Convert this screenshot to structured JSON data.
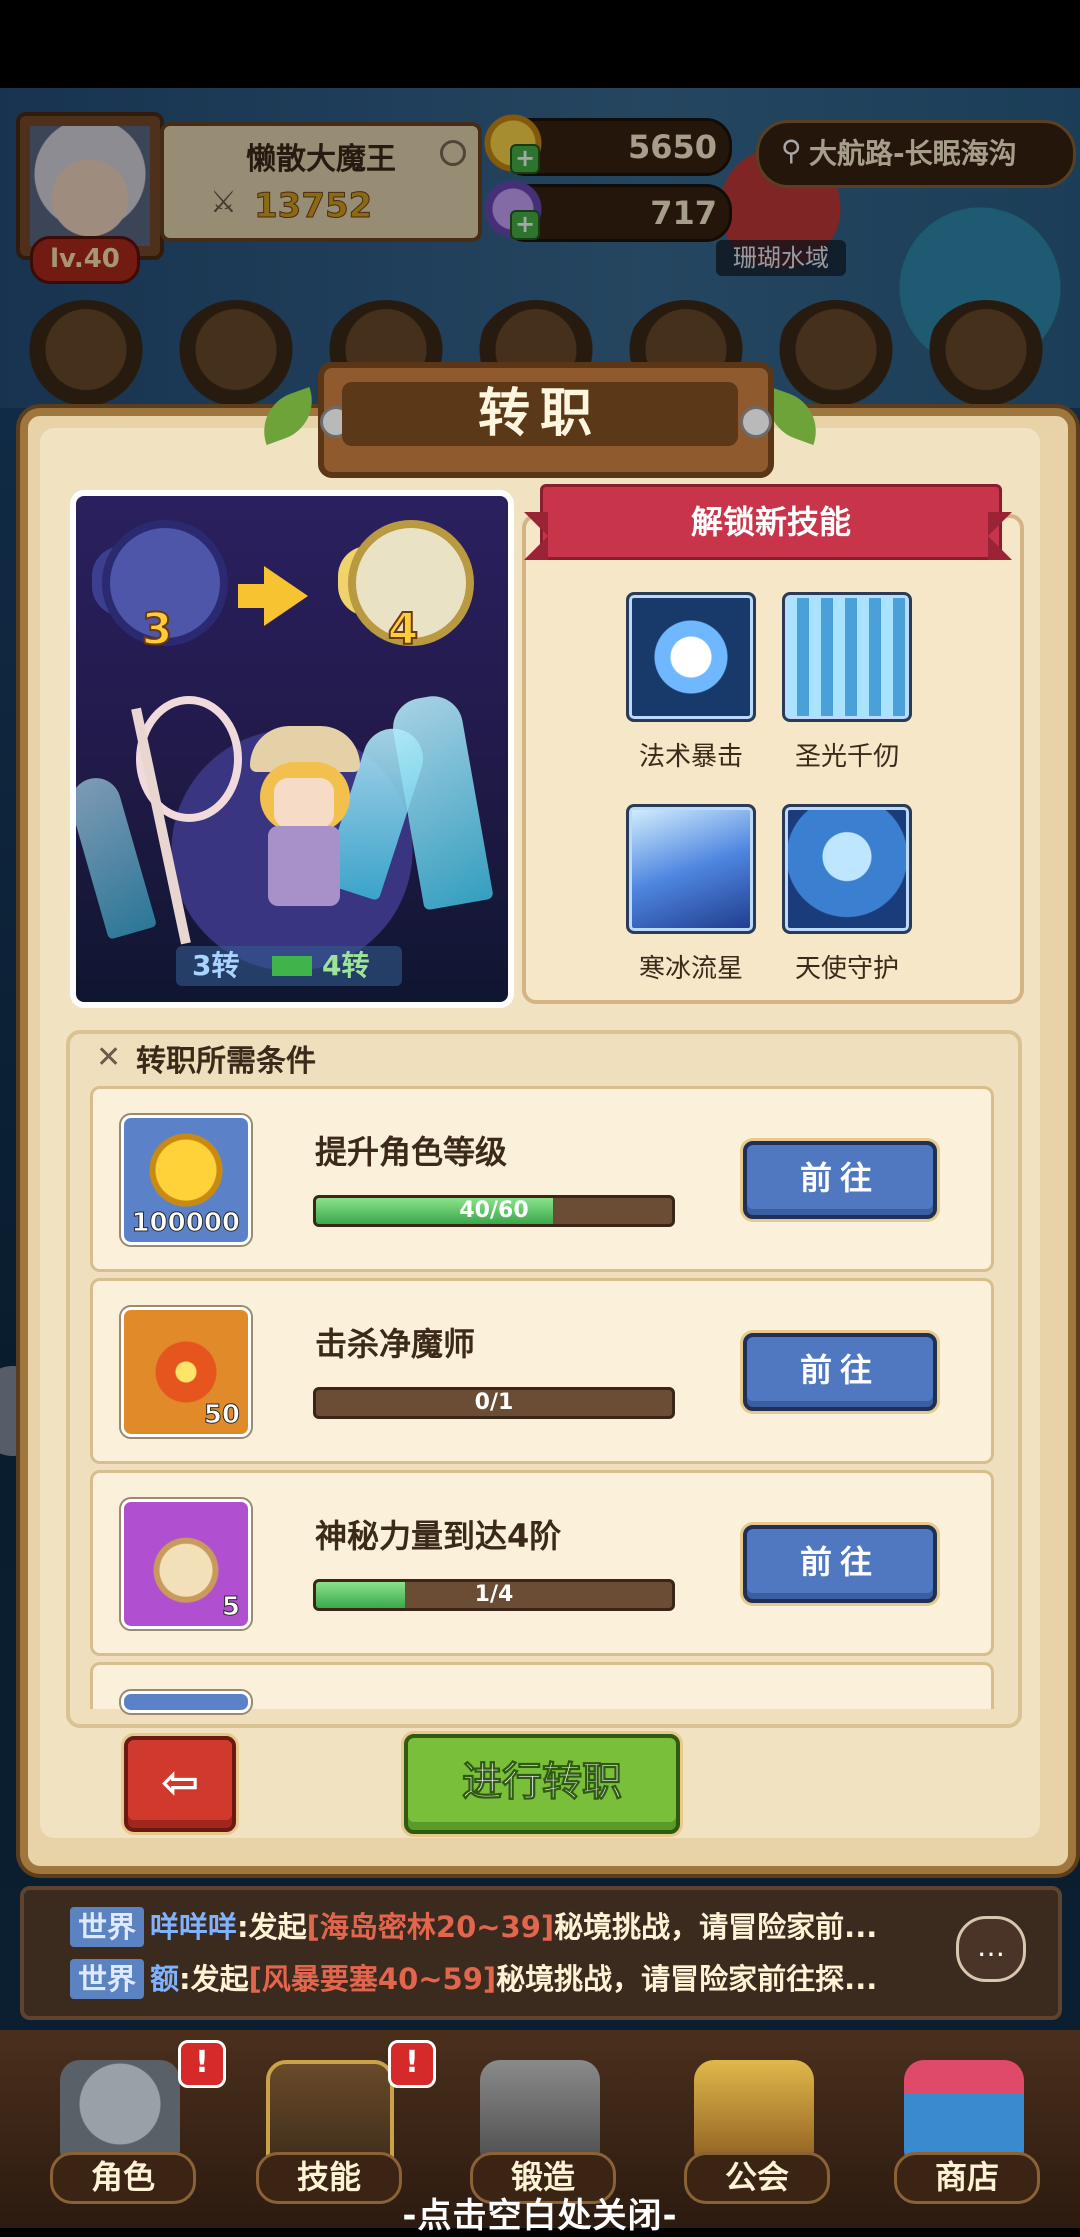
{
  "player": {
    "name": "懒散大魔王",
    "power": "13752",
    "level": "lv.40"
  },
  "resources": {
    "gold": "5650",
    "gems": "717"
  },
  "location": {
    "route": "大航路-长眠海沟",
    "region": "珊瑚水域"
  },
  "dialog": {
    "title": "转职",
    "preview": {
      "from_rank": "3",
      "to_rank": "4",
      "from_label": "3转",
      "to_label": "4转"
    },
    "skills_header": "解锁新技能",
    "skills": [
      {
        "name": "法术暴击",
        "icon": "spell-crit-icon"
      },
      {
        "name": "圣光千仞",
        "icon": "holy-light-icon"
      },
      {
        "name": "寒冰流星",
        "icon": "ice-meteor-icon"
      },
      {
        "name": "天使守护",
        "icon": "angel-guard-icon"
      }
    ],
    "conditions_title": "转职所需条件",
    "conditions": [
      {
        "label": "提升角色等级",
        "item": "gold-coin-icon",
        "item_count": "100000",
        "progress_text": "40/60",
        "progress": 0.667,
        "button": "前往"
      },
      {
        "label": "击杀净魔师",
        "item": "red-star-icon",
        "item_count": "50",
        "progress_text": "0/1",
        "progress": 0.0,
        "button": "前往"
      },
      {
        "label": "神秘力量到达4阶",
        "item": "fruit-tart-icon",
        "item_count": "5",
        "progress_text": "1/4",
        "progress": 0.25,
        "button": "前往"
      }
    ],
    "confirm": "进行转职"
  },
  "chat": [
    {
      "tag": "世界",
      "user": "咩咩咩",
      "prefix": ":发起",
      "highlight": "[海岛密林20~39]",
      "rest": "秘境挑战，请冒险家前..."
    },
    {
      "tag": "世界",
      "user": "额",
      "prefix": ":发起",
      "highlight": "[风暴要塞40~59]",
      "rest": "秘境挑战，请冒险家前往探..."
    }
  ],
  "nav": [
    {
      "label": "角色",
      "alert": "!"
    },
    {
      "label": "技能",
      "alert": "!"
    },
    {
      "label": "锻造",
      "alert": ""
    },
    {
      "label": "公会",
      "alert": ""
    },
    {
      "label": "商店",
      "alert": ""
    }
  ],
  "close_hint": "-点击空白处关闭-",
  "colors": {
    "panel": "#e8d2a8",
    "button_blue": "#4f78c0",
    "button_green": "#7abf3a",
    "button_red": "#d03a2c",
    "ribbon": "#c8344a"
  }
}
